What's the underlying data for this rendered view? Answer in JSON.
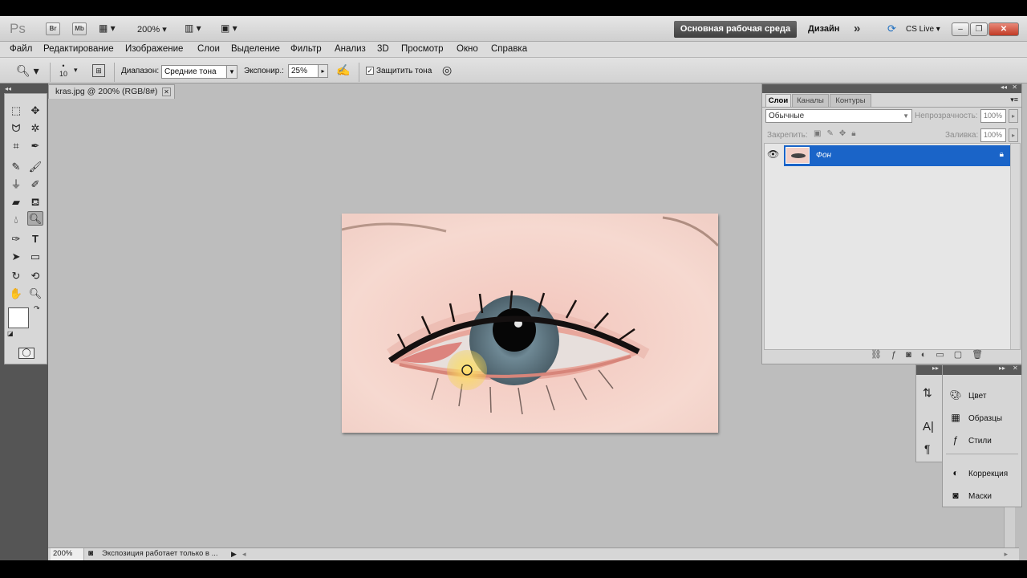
{
  "app": {
    "logo": "Ps",
    "bridge_label": "Br",
    "minibridge_label": "Mb",
    "zoom_level": "200%",
    "workspace_active": "Основная рабочая среда",
    "workspace_design": "Дизайн",
    "more_workspaces": "»",
    "cs_live": "CS Live"
  },
  "menu": [
    "Файл",
    "Редактирование",
    "Изображение",
    "Слои",
    "Выделение",
    "Фильтр",
    "Анализ",
    "3D",
    "Просмотр",
    "Окно",
    "Справка"
  ],
  "options": {
    "brush_size": "10",
    "range_label": "Диапазон:",
    "range_value": "Средние тона",
    "exposure_label": "Экспонир.:",
    "exposure_value": "25%",
    "protect_label": "Защитить тона",
    "protect_checked": true
  },
  "document": {
    "tab_title": "kras.jpg @ 200% (RGB/8#)",
    "status_zoom": "200%",
    "status_text": "Экспозиция работает только в ..."
  },
  "layers_panel": {
    "tabs": [
      "Слои",
      "Каналы",
      "Контуры"
    ],
    "blend_mode": "Обычные",
    "opacity_label": "Непрозрачность:",
    "opacity_value": "100%",
    "lock_label": "Закрепить:",
    "fill_label": "Заливка:",
    "fill_value": "100%",
    "layer_name": "Фон"
  },
  "dock": {
    "items": [
      "Цвет",
      "Образцы",
      "Стили",
      "Коррекция",
      "Маски"
    ]
  },
  "colors": {
    "accent": "#1a64c8",
    "workspace_bg": "#bdbdbd"
  }
}
